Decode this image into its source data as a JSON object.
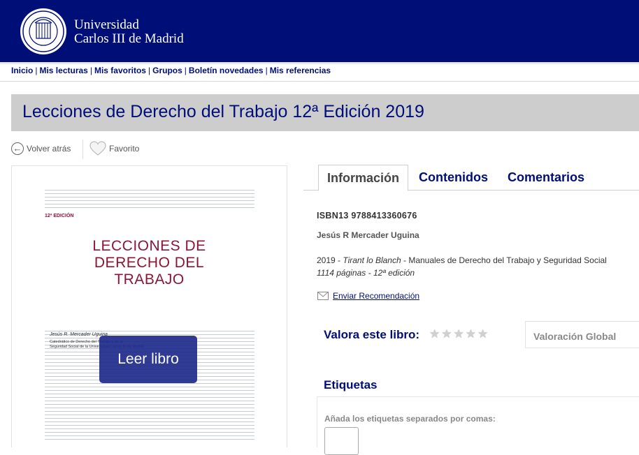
{
  "header": {
    "logo_line1": "Universidad",
    "logo_line2": "Carlos III de Madrid",
    "seal_icon": "university-seal-icon",
    "brand_color": "#000e78"
  },
  "nav": {
    "items": [
      "Inicio",
      "Mis lecturas",
      "Mis favoritos",
      "Grupos",
      "Boletín novedades",
      "Mis referencias"
    ],
    "separator": "|"
  },
  "page": {
    "title": "Lecciones de Derecho del Trabajo 12ª Edición 2019"
  },
  "actions": {
    "back_label": "Volver atrás",
    "back_icon": "arrow-left-icon",
    "favorite_label": "Favorito",
    "favorite_icon": "heart-icon"
  },
  "cover": {
    "edition": "12ª EDICIÓN",
    "title_lines": [
      "LECCIONES DE",
      "DERECHO DEL",
      "TRABAJO"
    ],
    "author": "Jesús R. Mercader Uguina",
    "affiliation_lines": [
      "Catedrático de Derecho del Trabajo y de la",
      "Seguridad Social de la Universidad Carlos III de Madrid"
    ],
    "read_button": "Leer libro"
  },
  "tabs": [
    {
      "label": "Información",
      "active": true
    },
    {
      "label": "Contenidos",
      "active": false
    },
    {
      "label": "Comentarios",
      "active": false
    }
  ],
  "info": {
    "isbn": "ISBN13 9788413360676",
    "author": "Jesús R Mercader Uguina",
    "year": "2019",
    "dash1": " - ",
    "publisher": "Tirant lo Blanch",
    "dash2": " -  ",
    "collection": "Manuales de Derecho del Trabajo y Seguridad Social",
    "pages": "1114 páginas - 12ª edición",
    "recommend_label": "Enviar Recomendación",
    "recommend_icon": "envelope-icon"
  },
  "rating": {
    "label": "Valora este libro:",
    "stars_total": 5,
    "stars_filled": 0,
    "star_icon": "star-icon",
    "global_label": "Valoración Global"
  },
  "tags": {
    "title": "Etiquetas",
    "hint": "Añada los etiquetas separados por comas:",
    "input_value": ""
  }
}
